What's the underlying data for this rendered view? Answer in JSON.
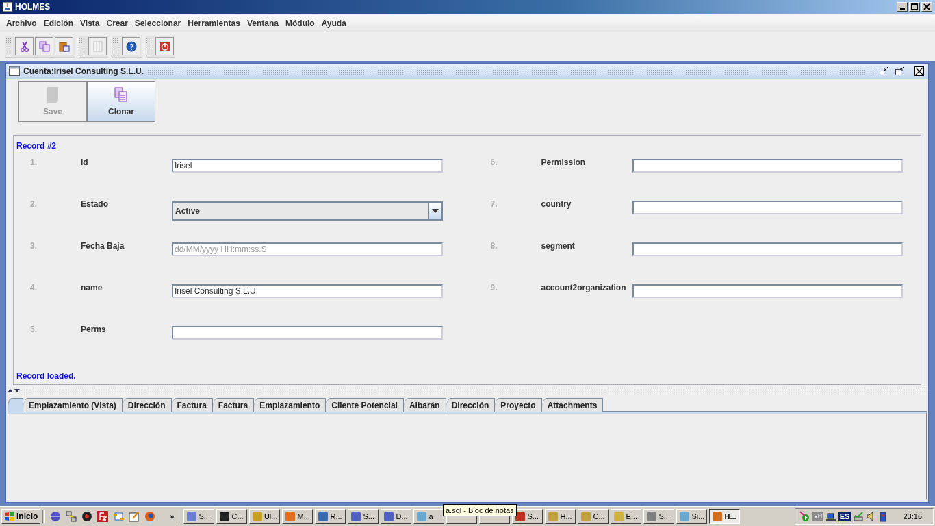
{
  "window": {
    "title": "HOLMES"
  },
  "menu": [
    "Archivo",
    "Edición",
    "Vista",
    "Crear",
    "Seleccionar",
    "Herramientas",
    "Ventana",
    "Módulo",
    "Ayuda"
  ],
  "frame": {
    "title": "Cuenta:Irisel Consulting S.L.U."
  },
  "actions": [
    {
      "label": "Save",
      "disabled": true
    },
    {
      "label": "Clonar",
      "disabled": false
    }
  ],
  "form": {
    "header": "Record #2",
    "status": "Record loaded.",
    "left": [
      {
        "number": "1.",
        "label": "Id",
        "kind": "text",
        "value": "Irisel"
      },
      {
        "number": "2.",
        "label": "Estado",
        "kind": "select",
        "value": "Active"
      },
      {
        "number": "3.",
        "label": "Fecha Baja",
        "kind": "text",
        "placeholder": "dd/MM/yyyy HH:mm:ss.S"
      },
      {
        "number": "4.",
        "label": "name",
        "kind": "text",
        "value": "Irisel Consulting S.L.U."
      },
      {
        "number": "5.",
        "label": "Perms",
        "kind": "text"
      }
    ],
    "right": [
      {
        "number": "6.",
        "label": "Permission",
        "kind": "text"
      },
      {
        "number": "7.",
        "label": "country",
        "kind": "text"
      },
      {
        "number": "8.",
        "label": "segment",
        "kind": "text"
      },
      {
        "number": "9.",
        "label": "account2organization",
        "kind": "text"
      }
    ]
  },
  "tabs": [
    {
      "selected": true
    },
    {
      "label": "Emplazamiento (Vista)",
      "selected": false
    },
    {
      "label": "Dirección",
      "selected": false
    },
    {
      "label": "Factura",
      "selected": false
    },
    {
      "label": "Factura",
      "selected": false
    },
    {
      "label": "Emplazamiento",
      "selected": false
    },
    {
      "label": "Cliente Potencial",
      "selected": false
    },
    {
      "label": "Albarán",
      "selected": false
    },
    {
      "label": "Dirección",
      "selected": false
    },
    {
      "label": "Proyecto",
      "selected": false
    },
    {
      "label": "Attachments",
      "selected": false
    }
  ],
  "taskbar": {
    "start": "Inicio",
    "more": "»",
    "tasks": [
      {
        "label": "S...",
        "selected": false
      },
      {
        "label": "C...",
        "selected": false
      },
      {
        "label": "Ul...",
        "selected": false
      },
      {
        "label": "M...",
        "selected": false
      },
      {
        "label": "R...",
        "selected": false
      },
      {
        "label": "S...",
        "selected": false
      },
      {
        "label": "D...",
        "selected": false
      },
      {
        "label": "a",
        "selected": false
      },
      {
        "selected": false
      },
      {
        "selected": false
      },
      {
        "label": "S...",
        "selected": false
      },
      {
        "label": "H...",
        "selected": false
      },
      {
        "label": "C...",
        "selected": false
      },
      {
        "label": "E...",
        "selected": false
      },
      {
        "label": "S...",
        "selected": false
      },
      {
        "label": "Si...",
        "selected": false
      },
      {
        "label": "H...",
        "selected": true
      }
    ],
    "language": "ES",
    "clock": "23:16"
  },
  "tooltip": "a.sql - Bloc de notas"
}
